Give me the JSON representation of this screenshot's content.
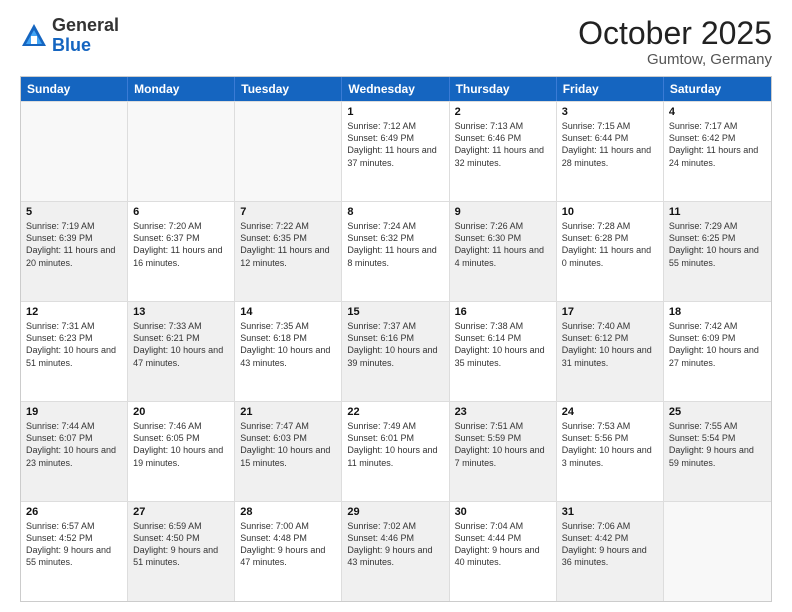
{
  "header": {
    "logo_general": "General",
    "logo_blue": "Blue",
    "month_title": "October 2025",
    "location": "Gumtow, Germany"
  },
  "days_of_week": [
    "Sunday",
    "Monday",
    "Tuesday",
    "Wednesday",
    "Thursday",
    "Friday",
    "Saturday"
  ],
  "weeks": [
    [
      {
        "day": "",
        "text": "",
        "empty": true
      },
      {
        "day": "",
        "text": "",
        "empty": true
      },
      {
        "day": "",
        "text": "",
        "empty": true
      },
      {
        "day": "1",
        "text": "Sunrise: 7:12 AM\nSunset: 6:49 PM\nDaylight: 11 hours and 37 minutes."
      },
      {
        "day": "2",
        "text": "Sunrise: 7:13 AM\nSunset: 6:46 PM\nDaylight: 11 hours and 32 minutes."
      },
      {
        "day": "3",
        "text": "Sunrise: 7:15 AM\nSunset: 6:44 PM\nDaylight: 11 hours and 28 minutes."
      },
      {
        "day": "4",
        "text": "Sunrise: 7:17 AM\nSunset: 6:42 PM\nDaylight: 11 hours and 24 minutes."
      }
    ],
    [
      {
        "day": "5",
        "text": "Sunrise: 7:19 AM\nSunset: 6:39 PM\nDaylight: 11 hours and 20 minutes.",
        "shaded": true
      },
      {
        "day": "6",
        "text": "Sunrise: 7:20 AM\nSunset: 6:37 PM\nDaylight: 11 hours and 16 minutes."
      },
      {
        "day": "7",
        "text": "Sunrise: 7:22 AM\nSunset: 6:35 PM\nDaylight: 11 hours and 12 minutes.",
        "shaded": true
      },
      {
        "day": "8",
        "text": "Sunrise: 7:24 AM\nSunset: 6:32 PM\nDaylight: 11 hours and 8 minutes."
      },
      {
        "day": "9",
        "text": "Sunrise: 7:26 AM\nSunset: 6:30 PM\nDaylight: 11 hours and 4 minutes.",
        "shaded": true
      },
      {
        "day": "10",
        "text": "Sunrise: 7:28 AM\nSunset: 6:28 PM\nDaylight: 11 hours and 0 minutes."
      },
      {
        "day": "11",
        "text": "Sunrise: 7:29 AM\nSunset: 6:25 PM\nDaylight: 10 hours and 55 minutes.",
        "shaded": true
      }
    ],
    [
      {
        "day": "12",
        "text": "Sunrise: 7:31 AM\nSunset: 6:23 PM\nDaylight: 10 hours and 51 minutes."
      },
      {
        "day": "13",
        "text": "Sunrise: 7:33 AM\nSunset: 6:21 PM\nDaylight: 10 hours and 47 minutes.",
        "shaded": true
      },
      {
        "day": "14",
        "text": "Sunrise: 7:35 AM\nSunset: 6:18 PM\nDaylight: 10 hours and 43 minutes."
      },
      {
        "day": "15",
        "text": "Sunrise: 7:37 AM\nSunset: 6:16 PM\nDaylight: 10 hours and 39 minutes.",
        "shaded": true
      },
      {
        "day": "16",
        "text": "Sunrise: 7:38 AM\nSunset: 6:14 PM\nDaylight: 10 hours and 35 minutes."
      },
      {
        "day": "17",
        "text": "Sunrise: 7:40 AM\nSunset: 6:12 PM\nDaylight: 10 hours and 31 minutes.",
        "shaded": true
      },
      {
        "day": "18",
        "text": "Sunrise: 7:42 AM\nSunset: 6:09 PM\nDaylight: 10 hours and 27 minutes."
      }
    ],
    [
      {
        "day": "19",
        "text": "Sunrise: 7:44 AM\nSunset: 6:07 PM\nDaylight: 10 hours and 23 minutes.",
        "shaded": true
      },
      {
        "day": "20",
        "text": "Sunrise: 7:46 AM\nSunset: 6:05 PM\nDaylight: 10 hours and 19 minutes."
      },
      {
        "day": "21",
        "text": "Sunrise: 7:47 AM\nSunset: 6:03 PM\nDaylight: 10 hours and 15 minutes.",
        "shaded": true
      },
      {
        "day": "22",
        "text": "Sunrise: 7:49 AM\nSunset: 6:01 PM\nDaylight: 10 hours and 11 minutes."
      },
      {
        "day": "23",
        "text": "Sunrise: 7:51 AM\nSunset: 5:59 PM\nDaylight: 10 hours and 7 minutes.",
        "shaded": true
      },
      {
        "day": "24",
        "text": "Sunrise: 7:53 AM\nSunset: 5:56 PM\nDaylight: 10 hours and 3 minutes."
      },
      {
        "day": "25",
        "text": "Sunrise: 7:55 AM\nSunset: 5:54 PM\nDaylight: 9 hours and 59 minutes.",
        "shaded": true
      }
    ],
    [
      {
        "day": "26",
        "text": "Sunrise: 6:57 AM\nSunset: 4:52 PM\nDaylight: 9 hours and 55 minutes."
      },
      {
        "day": "27",
        "text": "Sunrise: 6:59 AM\nSunset: 4:50 PM\nDaylight: 9 hours and 51 minutes.",
        "shaded": true
      },
      {
        "day": "28",
        "text": "Sunrise: 7:00 AM\nSunset: 4:48 PM\nDaylight: 9 hours and 47 minutes."
      },
      {
        "day": "29",
        "text": "Sunrise: 7:02 AM\nSunset: 4:46 PM\nDaylight: 9 hours and 43 minutes.",
        "shaded": true
      },
      {
        "day": "30",
        "text": "Sunrise: 7:04 AM\nSunset: 4:44 PM\nDaylight: 9 hours and 40 minutes."
      },
      {
        "day": "31",
        "text": "Sunrise: 7:06 AM\nSunset: 4:42 PM\nDaylight: 9 hours and 36 minutes.",
        "shaded": true
      },
      {
        "day": "",
        "text": "",
        "empty": true
      }
    ]
  ]
}
